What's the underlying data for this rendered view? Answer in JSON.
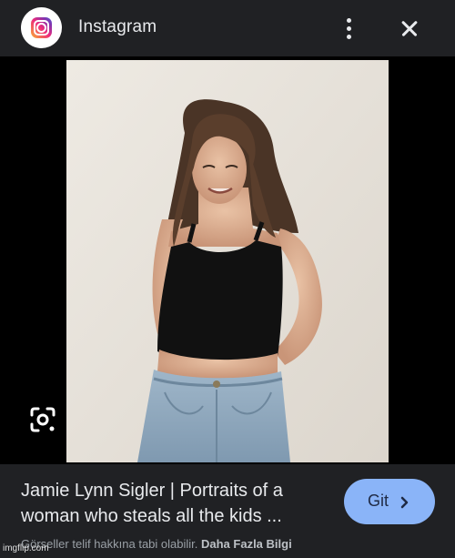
{
  "topbar": {
    "app_name": "Instagram",
    "logo_icon": "instagram-icon",
    "more_icon": "more-vert-icon",
    "close_icon": "close-icon"
  },
  "image": {
    "lens_icon": "google-lens-icon"
  },
  "result": {
    "title": "Jamie Lynn Sigler | Portraits of a\nwoman who steals all the kids ...",
    "visit_label": "Git",
    "visit_icon": "chevron-right-icon",
    "copyright_notice": "Görseller telif hakkına tabi olabilir.",
    "learn_more": "Daha Fazla Bilgi"
  },
  "watermark": "imgflip.com",
  "colors": {
    "bar_bg": "#202124",
    "accent_button": "#8ab4f8",
    "text_primary": "#e8eaed",
    "text_secondary": "#9aa0a6"
  }
}
